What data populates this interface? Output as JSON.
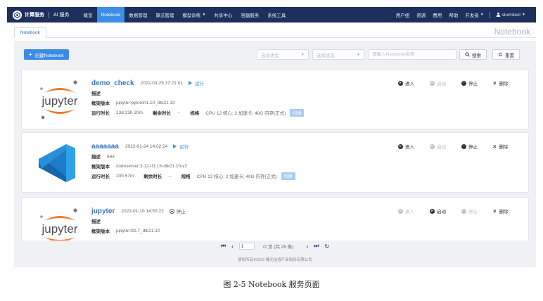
{
  "brand": {
    "name": "计算服务",
    "sub": "AI 服务"
  },
  "nav": {
    "items": [
      "概览",
      "Notebook",
      "数据管理",
      "算法管理",
      "模型训练",
      "共享中心",
      "容器服务",
      "系统工具"
    ],
    "dropdown_index": 4,
    "active_index": 1
  },
  "nav_right": {
    "items": [
      "用户组",
      "资源",
      "费用",
      "帮助",
      "开发者"
    ],
    "user": "slurmtest"
  },
  "tab": {
    "label": "Notebook"
  },
  "page_title": "Notebook",
  "toolbar": {
    "create_label": "创建Notebook",
    "type_placeholder": "选择类型",
    "status_placeholder": "选择状态",
    "search_placeholder": "请输入Notebook名称",
    "search_label": "搜索",
    "reset_label": "重置"
  },
  "labels": {
    "desc": "描述",
    "framework": "框架版本",
    "runtime": "运行时长",
    "remaining": "剩余时长",
    "spec": "规格",
    "switch": "切换",
    "enter": "进入",
    "start": "启动",
    "stop": "停止",
    "delete": "删除"
  },
  "cards": [
    {
      "name": "demo_check",
      "time": "2022-03-25 17:21:01",
      "status": "运行",
      "logo": "jupyter-logo",
      "logo_text": "jupyter",
      "desc": "",
      "framework": "jupyter:pytorch1.10_dtk21.10",
      "runtime": "13d 23h 20m",
      "remaining": "--",
      "spec": "CPU 12 核心; 2 加速卡; 40G 内存(正式)"
    },
    {
      "name": "aaaaaaa",
      "time": "2022-01-24 14:02:24",
      "status": "运行",
      "logo": "vscode-logo",
      "desc": "aaa",
      "framework": "codeserver:3.12-tf1.15-dtk21.10-v2",
      "runtime": "20h 57m",
      "remaining": "--",
      "spec": "CPU 12 核心; 2 加速卡; 40G 内存(正式)"
    },
    {
      "name": "jupyter",
      "time": "2022-01-10 14:50:22",
      "status": "停止",
      "logo": "jupyter-logo",
      "logo_text": "jupyter",
      "desc": "",
      "framework": "jupyter:tf2.7_dtk21.10"
    }
  ],
  "pager": {
    "current": "1",
    "summary": "/2 页 (共 25 条)"
  },
  "footer": "版权所有©2022 曙光信息产业股份有限公司",
  "caption": "图 2-5 Notebook 服务页面",
  "colors": {
    "nav_bg": "#1d2f5c",
    "active": "#3a8ee6",
    "link": "#3a74c0",
    "panel_bg": "#eff1f4",
    "jupyter_orange": "#f37726"
  }
}
